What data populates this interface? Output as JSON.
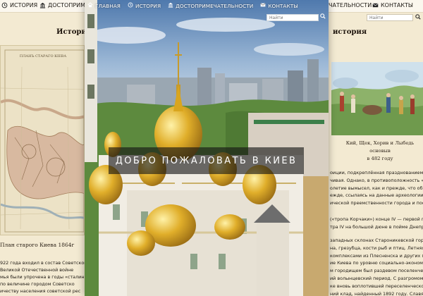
{
  "bg_nav": {
    "items_left": [
      "ИСТОРИЯ",
      "ДОСТОПРИМЕ"
    ],
    "items_right": [
      "ЧАТЕЛЬНОСТИ",
      "КОНТАКТЫ"
    ],
    "search_placeholder": "Найти"
  },
  "left_column": {
    "heading": "Истори",
    "map_caption": "План старого Киева 1864г",
    "text_lines": [
      "922 года входил в состав Советског",
      "Великой Отечественной войне",
      "мья были упрочена в годы «сталин",
      "по величине городом Советско",
      "ичеству населения советской рес"
    ]
  },
  "right_column": {
    "heading": "история",
    "painting_caption": "Кий, Щек, Хорив и Лыбедь основыв\nв 482 году",
    "text_block_1": [
      "оиции, подкреплённая празднованием в 1",
      "чивая. Однако, в противоположность «ко",
      "олетие вымысел, как и прежде, что образ",
      "ежде, ссылаясь на данные археологии; пр",
      "ической преемственности города и поселений"
    ],
    "text_block_2": [
      "(«тропа Корчаки») конце IV — первой пол",
      "тра IV на большой дюне в пойме Днепра"
    ],
    "text_block_3": [
      "западных склонах Староникевской горы, с",
      "на, грезубца, кости рыб и птиц. Летняя кера",
      "комплексами из Плесненска и других посе",
      "ие Киева по уровню социально-экономич",
      "м городищем был раздевом поселенческой",
      "ий волынцевский период. С разгромом в",
      "ке вновь воплотившей переселенческой культуры",
      "ний клад, найденный 1892 году. Славянск"
    ]
  },
  "overlay": {
    "nav": [
      {
        "icon": "home-icon",
        "label": "ГЛАВНАЯ"
      },
      {
        "icon": "history-icon",
        "label": "ИСТОРИЯ"
      },
      {
        "icon": "landmark-icon",
        "label": "ДОСТОПРИМЕЧАТЕЛЬНОСТИ"
      },
      {
        "icon": "mail-icon",
        "label": "КОНТАКТЫ"
      }
    ],
    "search_placeholder": "Найти",
    "welcome_text": "ДОБРО ПОЖАЛОВАТЬ В КИЕВ"
  },
  "colors": {
    "page_bg": "#f3ead2",
    "overlay_banner": "#141414",
    "gold_domes": "#d9a51e",
    "sky": "#6b8fb8"
  }
}
